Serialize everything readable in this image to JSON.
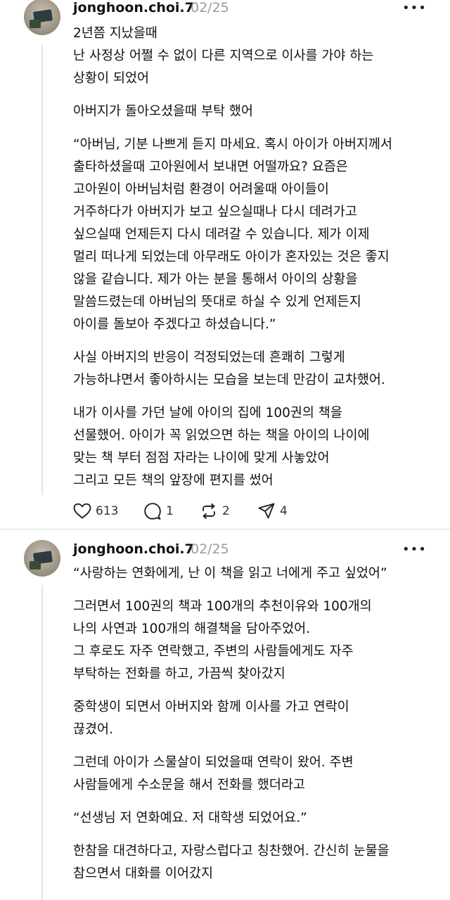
{
  "posts": [
    {
      "username": "jonghoon.choi.7",
      "date": "02/25",
      "lines": [
        "2년쯤 지났을때",
        "난 사정상 어쩔 수 없이 다른 지역으로 이사를 가야 하는",
        "상황이 되었어",
        "아버지가 돌아오셨을때 부탁 했어",
        "“아버님, 기분 나쁘게 듣지 마세요. 혹시 아이가 아버지께서",
        "출타하셨을때 고아원에서 보내면 어떨까요? 요즘은",
        "고아원이 아버님처럼 환경이 어려울때 아이들이",
        "거주하다가 아버지가 보고 싶으실때나 다시 데려가고",
        "싶으실때 언제든지 다시 데려갈 수 있습니다. 제가 이제",
        "멀리 떠나게 되었는데 아무래도 아이가 혼자있는 것은 좋지",
        "않을 같습니다. 제가 아는 분을 통해서 아이의 상황을",
        "말씀드렸는데 아버님의 뜻대로 하실 수 있게 언제든지",
        "아이를 돌보아 주겠다고 하셨습니다.”",
        "사실 아버지의 반응이 걱정되었는데 흔쾌히 그렇게",
        "가능하냐면서 좋아하시는 모습을 보는데 만감이 교차했어.",
        "내가 이사를 가던 날에 아이의 집에 100권의 책을",
        "선물했어. 아이가 꼭 읽었으면 하는 책을 아이의 나이에",
        "맞는 책 부터 점점 자라는 나이에 맞게 사놓았어",
        "그리고 모든 책의 앞장에 편지를 썼어"
      ],
      "likes": "613",
      "replies": "1",
      "reposts": "2",
      "shares": "4"
    },
    {
      "username": "jonghoon.choi.7",
      "date": "02/25",
      "lines": [
        "“사랑하는 연화에게, 난 이 책을 읽고 너에게 주고 싶었어”",
        "그러면서 100권의 책과 100개의 추천이유와 100개의",
        "나의 사연과 100개의 해결책을 담아주었어.",
        "그 후로도 자주 연락했고, 주변의 사람들에게도 자주",
        "부탁하는 전화를 하고, 가끔씩 찾아갔지",
        "중학생이 되면서 아버지와 함께 이사를 가고 연락이",
        "끊겼어.",
        "그런데 아이가 스물살이 되었을때 연락이 왔어. 주변",
        "사람들에게 수소문을 해서 전화를 했더라고",
        "“선생님 저 연화예요.  저 대학생 되었어요.”",
        "한참을 대견하다고, 자랑스럽다고 칭찬했어. 간신히 눈물을",
        "참으면서 대화를 이어갔지"
      ]
    }
  ],
  "icons": {
    "more": "more-horizontal-icon",
    "like": "heart-icon",
    "reply": "comment-bubble-icon",
    "repost": "repost-arrows-icon",
    "share": "send-arrow-icon"
  },
  "colors": {
    "text": "#111111",
    "muted": "#9a9a9a",
    "divider": "#dddddd"
  }
}
